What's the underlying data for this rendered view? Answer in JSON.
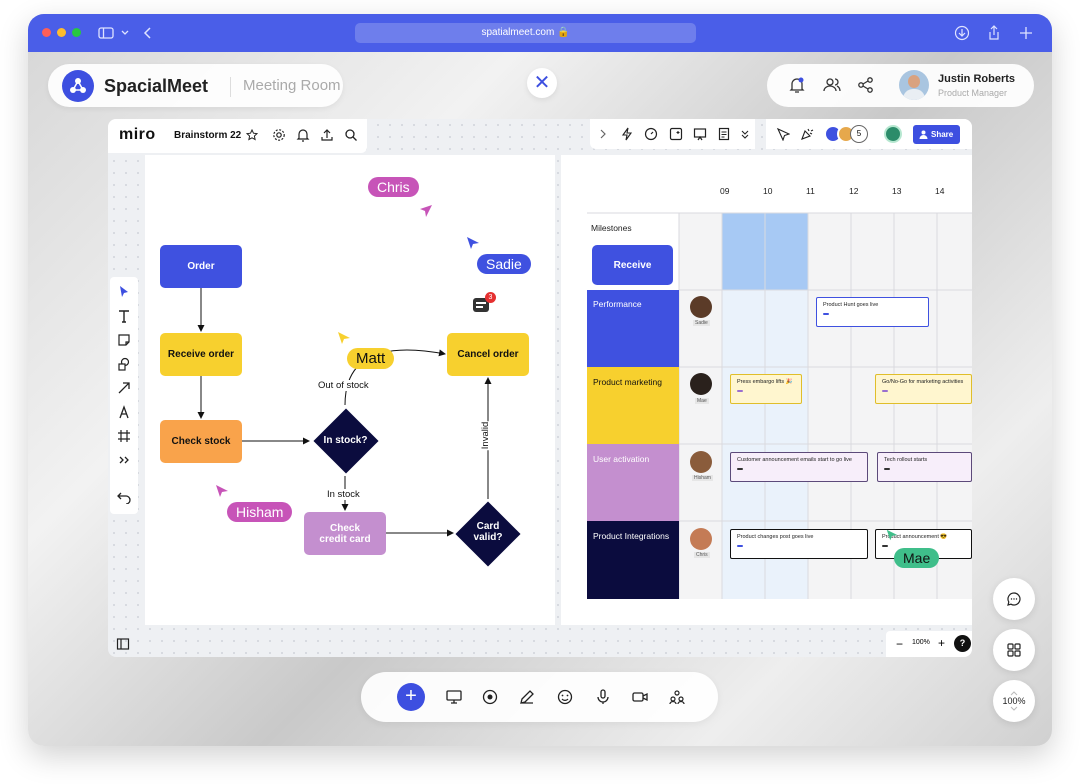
{
  "browser": {
    "url": "spatialmeet.com"
  },
  "app": {
    "brand": "SpacialMeet",
    "room": "Meeting Room"
  },
  "user": {
    "name": "Justin Roberts",
    "role": "Product Manager"
  },
  "miro": {
    "logo": "miro",
    "board_name": "Brainstorm 22",
    "share_label": "Share",
    "collaborator_count": "5",
    "zoom": "100%",
    "help": "?"
  },
  "flow": {
    "order": "Order",
    "receive": "Receive order",
    "check_stock": "Check stock",
    "in_stock": "In stock?",
    "cancel": "Cancel order",
    "check_card": "Check credit card",
    "card_valid": "Card valid?",
    "out_of_stock": "Out of stock",
    "in_stock_label": "In stock",
    "invalid": "Invalid",
    "comment_count": "3"
  },
  "cursors": {
    "chris": "Chris",
    "sadie": "Sadie",
    "matt": "Matt",
    "hisham": "Hisham",
    "mae": "Mae"
  },
  "timeline": {
    "days": [
      "09",
      "10",
      "11",
      "12",
      "13",
      "14"
    ],
    "milestones": "Milestones",
    "receive": "Receive",
    "rows": [
      {
        "label": "Performance",
        "avatar": "Sadie",
        "color": "#3f51e0"
      },
      {
        "label": "Product marketing",
        "avatar": "Mae",
        "color": "#f7d02e"
      },
      {
        "label": "User activation",
        "avatar": "Hisham",
        "color": "#c48fcf"
      },
      {
        "label": "Product Integrations",
        "avatar": "Chris",
        "color": "#0b0c3e"
      }
    ],
    "cards": {
      "c1": "Product Hunt goes live",
      "c2": "Press embargo lifts 🎉",
      "c3": "Go/No-Go for marketing activities",
      "c4": "Customer announcement emails start to go live",
      "c5": "Tech rollout starts",
      "c6": "Product changes post goes live",
      "c7": "Product announcement 😎"
    }
  },
  "right": {
    "zoom": "100%"
  }
}
